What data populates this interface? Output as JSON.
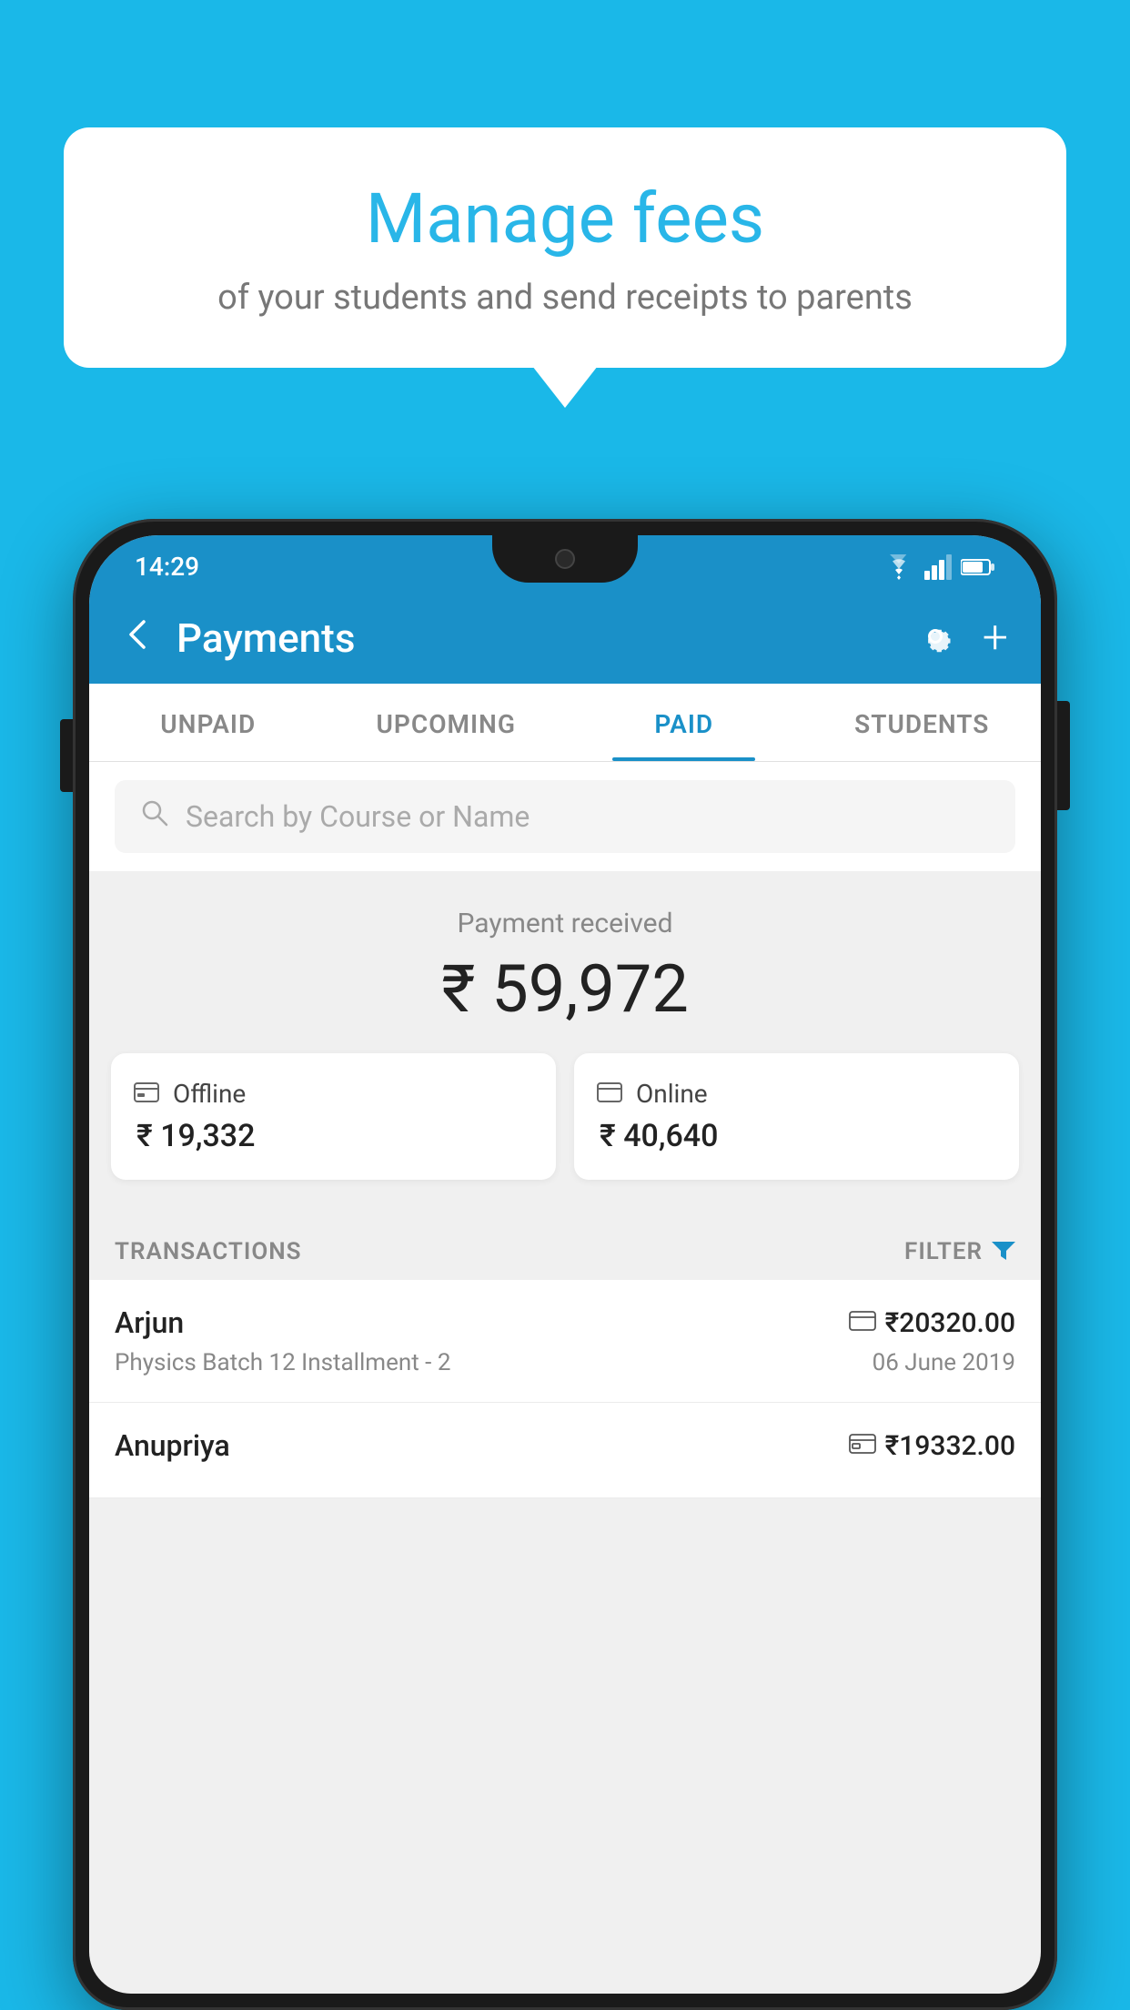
{
  "background_color": "#1ab8e8",
  "speech_bubble": {
    "title": "Manage fees",
    "subtitle": "of your students and send receipts to parents"
  },
  "status_bar": {
    "time": "14:29",
    "wifi": "▼",
    "signal": "▲",
    "battery": "▮"
  },
  "app_bar": {
    "title": "Payments",
    "back_label": "←",
    "gear_label": "⚙",
    "plus_label": "+"
  },
  "tabs": [
    {
      "label": "UNPAID",
      "active": false
    },
    {
      "label": "UPCOMING",
      "active": false
    },
    {
      "label": "PAID",
      "active": true
    },
    {
      "label": "STUDENTS",
      "active": false
    }
  ],
  "search": {
    "placeholder": "Search by Course or Name"
  },
  "payment_summary": {
    "received_label": "Payment received",
    "total_amount": "₹ 59,972",
    "offline_label": "Offline",
    "offline_amount": "₹ 19,332",
    "online_label": "Online",
    "online_amount": "₹ 40,640"
  },
  "transactions_section": {
    "label": "TRANSACTIONS",
    "filter_label": "FILTER"
  },
  "transactions": [
    {
      "name": "Arjun",
      "course": "Physics Batch 12 Installment - 2",
      "amount": "₹20320.00",
      "date": "06 June 2019",
      "payment_type": "card"
    },
    {
      "name": "Anupriya",
      "course": "",
      "amount": "₹19332.00",
      "date": "",
      "payment_type": "cash"
    }
  ]
}
